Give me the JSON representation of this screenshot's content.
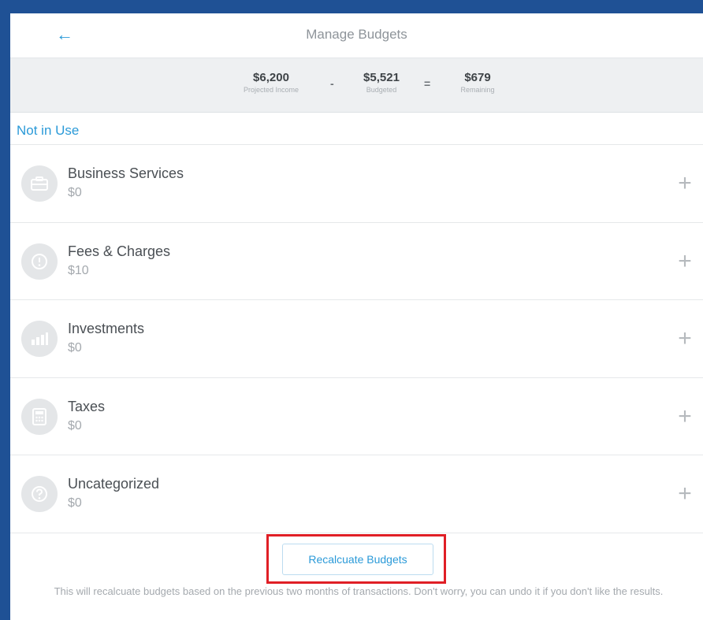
{
  "header": {
    "back_icon": "←",
    "title": "Manage Budgets"
  },
  "summary": {
    "projected_income": {
      "value": "$6,200",
      "label": "Projected Income"
    },
    "minus": "-",
    "budgeted": {
      "value": "$5,521",
      "label": "Budgeted"
    },
    "equals": "=",
    "remaining": {
      "value": "$679",
      "label": "Remaining"
    }
  },
  "section": {
    "label": "Not in Use"
  },
  "items": [
    {
      "name": "Business Services",
      "amount": "$0",
      "icon": "briefcase-icon"
    },
    {
      "name": "Fees & Charges",
      "amount": "$10",
      "icon": "fees-icon"
    },
    {
      "name": "Investments",
      "amount": "$0",
      "icon": "chart-icon"
    },
    {
      "name": "Taxes",
      "amount": "$0",
      "icon": "calculator-icon"
    },
    {
      "name": "Uncategorized",
      "amount": "$0",
      "icon": "question-icon"
    }
  ],
  "add_icon": "+",
  "recalculate": {
    "label": "Recalcuate Budgets",
    "note": "This will recalcuate budgets based on the previous two months of transactions. Don't worry, you can undo it if you don't like the results."
  },
  "colors": {
    "frame": "#1f5195",
    "accent": "#2b9ad8",
    "highlight": "#e01f26"
  }
}
